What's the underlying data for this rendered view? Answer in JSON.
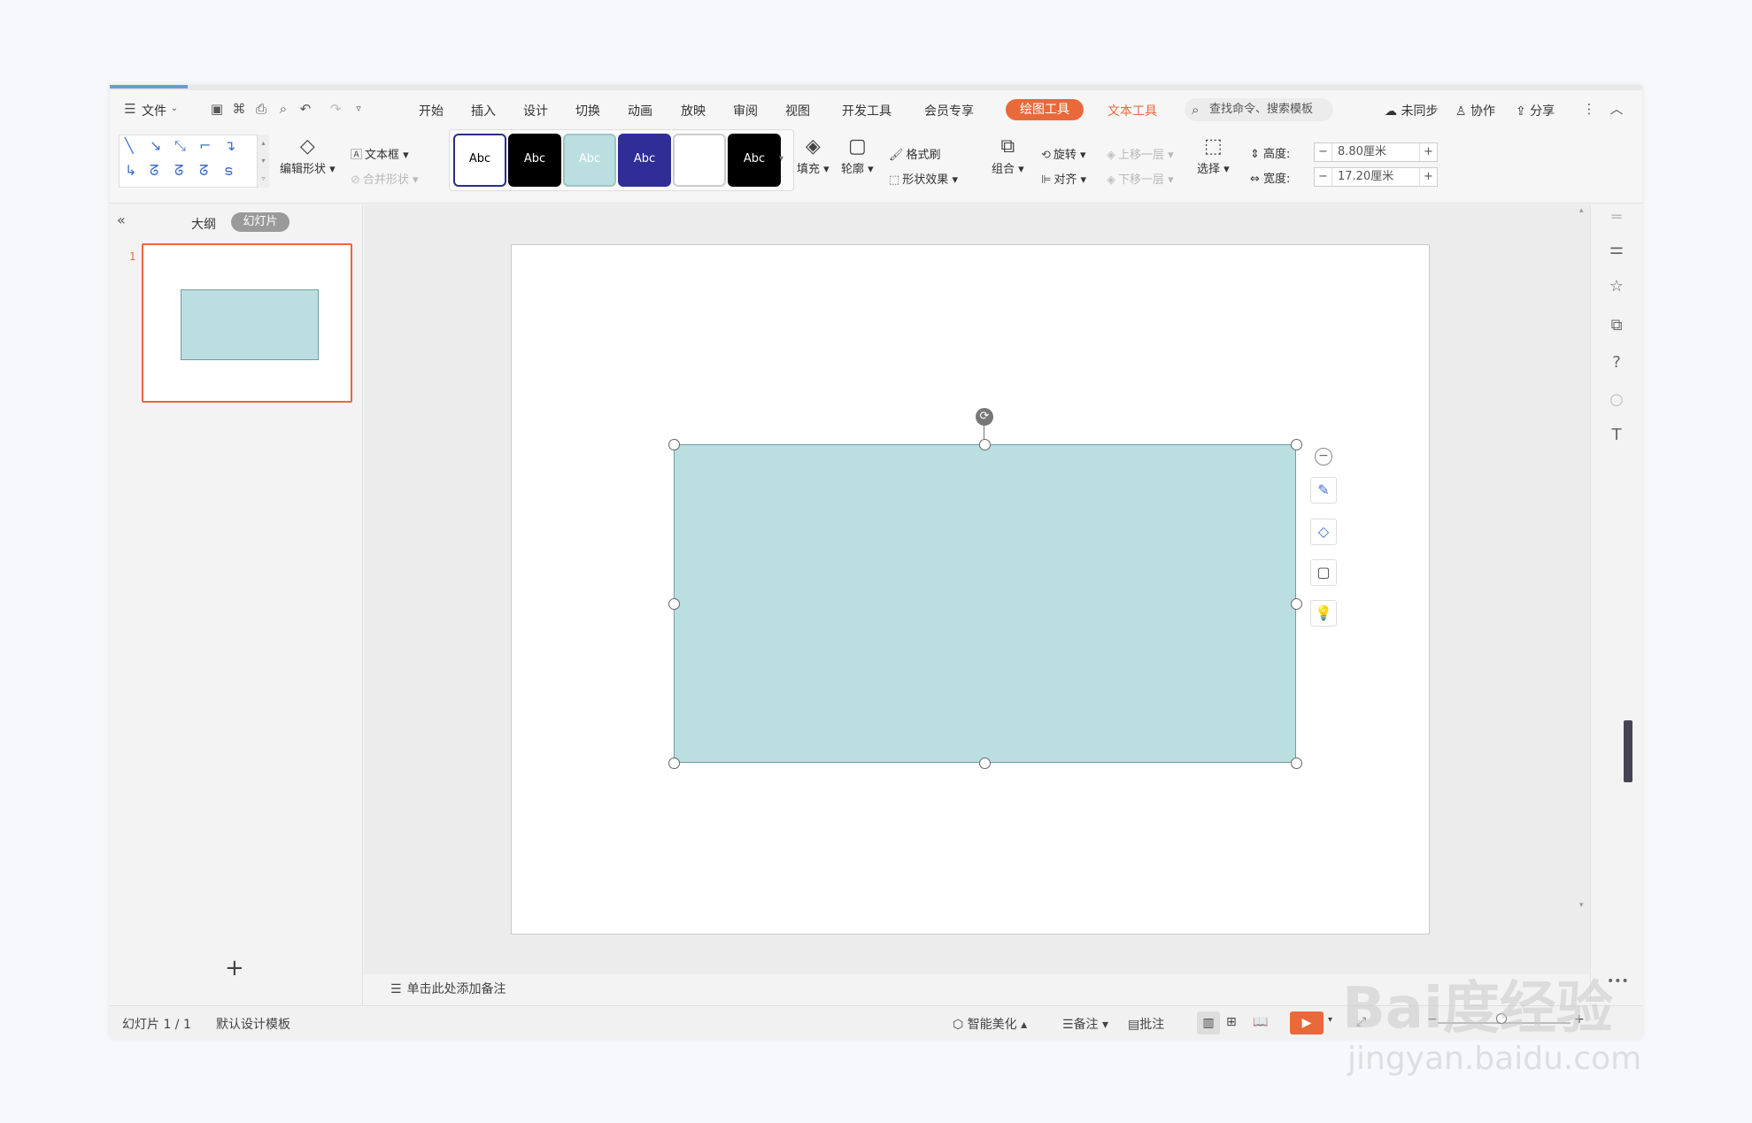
{
  "menubar": {
    "file_label": "文件",
    "tabs": [
      "开始",
      "插入",
      "设计",
      "切换",
      "动画",
      "放映",
      "审阅",
      "视图",
      "开发工具",
      "会员专享"
    ],
    "drawing_tools": "绘图工具",
    "text_tools": "文本工具",
    "search_placeholder": "查找命令、搜索模板",
    "sync": "未同步",
    "collab": "协作",
    "share": "分享"
  },
  "ribbon": {
    "edit_shape": "编辑形状",
    "text_box": "文本框",
    "merge_shape": "合并形状",
    "style_label": "Abc",
    "fill": "填充",
    "outline": "轮廓",
    "format_painter": "格式刷",
    "shape_effects": "形状效果",
    "group": "组合",
    "rotate": "旋转",
    "align": "对齐",
    "bring_forward": "上移一层",
    "send_backward": "下移一层",
    "select": "选择",
    "height_label": "高度:",
    "height_value": "8.80厘米",
    "width_label": "宽度:",
    "width_value": "17.20厘米",
    "styles": [
      {
        "bg": "#ffffff",
        "fg": "#000000",
        "border": "#2c2c8c"
      },
      {
        "bg": "#000000",
        "fg": "#ffffff",
        "border": "#000000"
      },
      {
        "bg": "#bbdfe1",
        "fg": "#ffffff",
        "border": "#9ec5c7"
      },
      {
        "bg": "#2e2e96",
        "fg": "#ffffff",
        "border": "#2e2e96"
      },
      {
        "bg": "#ffffff",
        "fg": "#ffffff",
        "border": "#cccccc"
      },
      {
        "bg": "#000000",
        "fg": "#ffffff",
        "border": "#000000"
      }
    ]
  },
  "leftpanel": {
    "outline_tab": "大纲",
    "slides_tab": "幻灯片",
    "slide_number": "1"
  },
  "notes": {
    "placeholder": "单击此处添加备注"
  },
  "statusbar": {
    "slide_count": "幻灯片 1 / 1",
    "template": "默认设计模板",
    "smart_beautify": "智能美化",
    "notes": "备注",
    "comments": "批注"
  },
  "colors": {
    "accent": "#e9693a",
    "shape_fill": "#bbdfe1",
    "shape_border": "#6d9ea1"
  },
  "watermark": {
    "logo": "Bai度经验",
    "url": "jingyan.baidu.com"
  }
}
